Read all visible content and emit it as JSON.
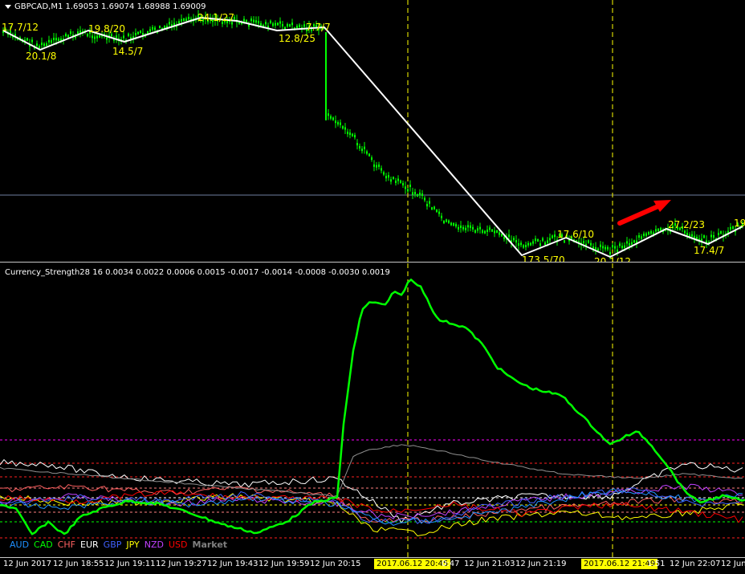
{
  "price_chart": {
    "title": "GBPCAD,M1  1.69053 1.69074 1.68988 1.69009",
    "symbol": "GBPCAD,M1",
    "ohlc": "1.69053 1.69074 1.68988 1.69009",
    "zigzag_labels": [
      "17.7/12",
      "20.1/8",
      "19.8/20",
      "14.5/7",
      "24.1/27",
      "12.8/25",
      "7.7/7",
      "173.5/70",
      "17.6/10",
      "20.1/12",
      "27.2/23",
      "17.4/7",
      "19"
    ],
    "colors": {
      "candles": "#00ff00",
      "zigzag": "#ffffff",
      "labels": "#ffff00",
      "hline": "#7080a0",
      "arrow": "#ff0000",
      "vlines": "#ffff00"
    }
  },
  "indicator": {
    "title": "Currency_Strength28 16 0.0034 0.0022 0.0006 0.0015 -0.0017 -0.0014 -0.0008 -0.0030 0.0019",
    "legend": [
      {
        "label": "AUD",
        "color": "#1e90ff"
      },
      {
        "label": "CAD",
        "color": "#00ff00"
      },
      {
        "label": "CHF",
        "color": "#ff6060"
      },
      {
        "label": "EUR",
        "color": "#ffffff"
      },
      {
        "label": "GBP",
        "color": "#4060ff"
      },
      {
        "label": "JPY",
        "color": "#ffff00"
      },
      {
        "label": "NZD",
        "color": "#c040ff"
      },
      {
        "label": "USD",
        "color": "#ff0000"
      }
    ],
    "market_label": "Market"
  },
  "time_axis": {
    "ticks": [
      "12 Jun 2017",
      "12 Jun 18:55",
      "12 Jun 19:11",
      "12 Jun 19:27",
      "12 Jun 19:43",
      "12 Jun 19:59",
      "12 Jun 20:15",
      "0:47",
      "12 Jun 21:03",
      "12 Jun 21:19",
      "1:51",
      "12 Jun 22:07",
      "12 Jun"
    ],
    "highlight_1": "2017.06.12 20:45",
    "highlight_2": "2017.06.12 21:49"
  }
}
